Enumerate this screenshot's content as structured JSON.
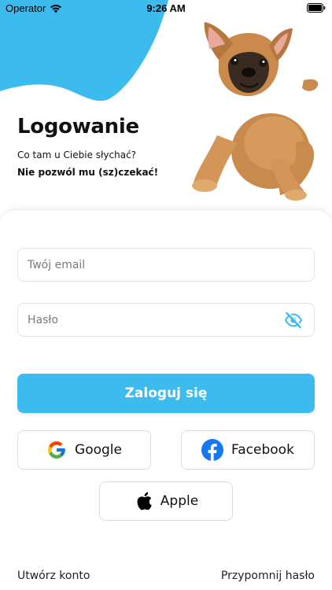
{
  "status_bar": {
    "carrier": "Operator",
    "time": "9:26 AM"
  },
  "header": {
    "title": "Logowanie",
    "subtitle": "Co tam u Ciebie słychać?",
    "subtitle_bold": "Nie pozwól mu (sz)czekać!"
  },
  "form": {
    "email_placeholder": "Twój email",
    "password_placeholder": "Hasło",
    "login_label": "Zaloguj się"
  },
  "social": {
    "google_label": "Google",
    "facebook_label": "Facebook",
    "apple_label": "Apple"
  },
  "footer": {
    "create_account": "Utwórz konto",
    "remind_password": "Przypomnij hasło"
  },
  "colors": {
    "accent": "#3cbbee",
    "blob": "#3cbbee",
    "text": "#111111"
  },
  "icons": {
    "wifi": "wifi-icon",
    "battery": "battery-icon",
    "eye": "eye-slash-icon",
    "google": "google-icon",
    "facebook": "facebook-icon",
    "apple": "apple-icon"
  }
}
